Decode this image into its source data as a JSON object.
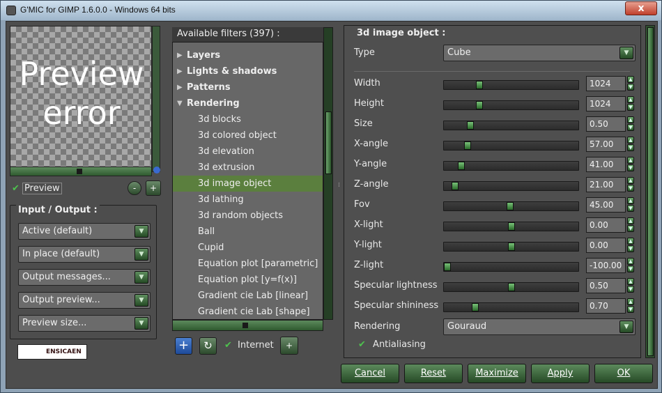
{
  "window": {
    "title": "G'MIC for GIMP 1.6.0.0 - Windows 64 bits",
    "close": "x"
  },
  "preview": {
    "error_text": "Preview error",
    "checkbox_label": "Preview",
    "zoom_out": "-",
    "zoom_in": "+"
  },
  "io": {
    "title": "Input / Output :",
    "combos": [
      "Active (default)",
      "In place (default)",
      "Output messages...",
      "Output preview...",
      "Preview size..."
    ]
  },
  "logo": {
    "text": "ENSICAEN"
  },
  "filters": {
    "header": "Available filters (397) :",
    "items": [
      {
        "label": "Layers",
        "kind": "cat",
        "open": false
      },
      {
        "label": "Lights & shadows",
        "kind": "cat",
        "open": false
      },
      {
        "label": "Patterns",
        "kind": "cat",
        "open": false
      },
      {
        "label": "Rendering",
        "kind": "cat",
        "open": true
      },
      {
        "label": "3d blocks",
        "kind": "sub"
      },
      {
        "label": "3d colored object",
        "kind": "sub"
      },
      {
        "label": "3d elevation",
        "kind": "sub"
      },
      {
        "label": "3d extrusion",
        "kind": "sub"
      },
      {
        "label": "3d image object",
        "kind": "sub",
        "selected": true
      },
      {
        "label": "3d lathing",
        "kind": "sub"
      },
      {
        "label": "3d random objects",
        "kind": "sub"
      },
      {
        "label": "Ball",
        "kind": "sub"
      },
      {
        "label": "Cupid",
        "kind": "sub"
      },
      {
        "label": "Equation plot [parametric]",
        "kind": "sub"
      },
      {
        "label": "Equation plot [y=f(x)]",
        "kind": "sub"
      },
      {
        "label": "Gradient cie Lab [linear]",
        "kind": "sub"
      },
      {
        "label": "Gradient cie Lab [shape]",
        "kind": "sub"
      }
    ],
    "add_icon": "+",
    "refresh_icon": "↻",
    "internet_label": "Internet",
    "internet_zoom": "+"
  },
  "params": {
    "title": "3d image object :",
    "type_label": "Type",
    "type_value": "Cube",
    "sliders": [
      {
        "label": "Width",
        "value": "1024",
        "pos": 0.25
      },
      {
        "label": "Height",
        "value": "1024",
        "pos": 0.25
      },
      {
        "label": "Size",
        "value": "0.50",
        "pos": 0.18
      },
      {
        "label": "X-angle",
        "value": "57.00",
        "pos": 0.16
      },
      {
        "label": "Y-angle",
        "value": "41.00",
        "pos": 0.11
      },
      {
        "label": "Z-angle",
        "value": "21.00",
        "pos": 0.06
      },
      {
        "label": "Fov",
        "value": "45.00",
        "pos": 0.49
      },
      {
        "label": "X-light",
        "value": "0.00",
        "pos": 0.5
      },
      {
        "label": "Y-light",
        "value": "0.00",
        "pos": 0.5
      },
      {
        "label": "Z-light",
        "value": "-100.00",
        "pos": 0.0
      },
      {
        "label": "Specular lightness",
        "value": "0.50",
        "pos": 0.5
      },
      {
        "label": "Specular shininess",
        "value": "0.70",
        "pos": 0.22
      }
    ],
    "rendering_label": "Rendering",
    "rendering_value": "Gouraud",
    "antialiasing_label": "Antialiasing"
  },
  "buttons": {
    "cancel": "Cancel",
    "reset": "Reset",
    "maximize": "Maximize",
    "apply": "Apply",
    "ok": "OK"
  }
}
